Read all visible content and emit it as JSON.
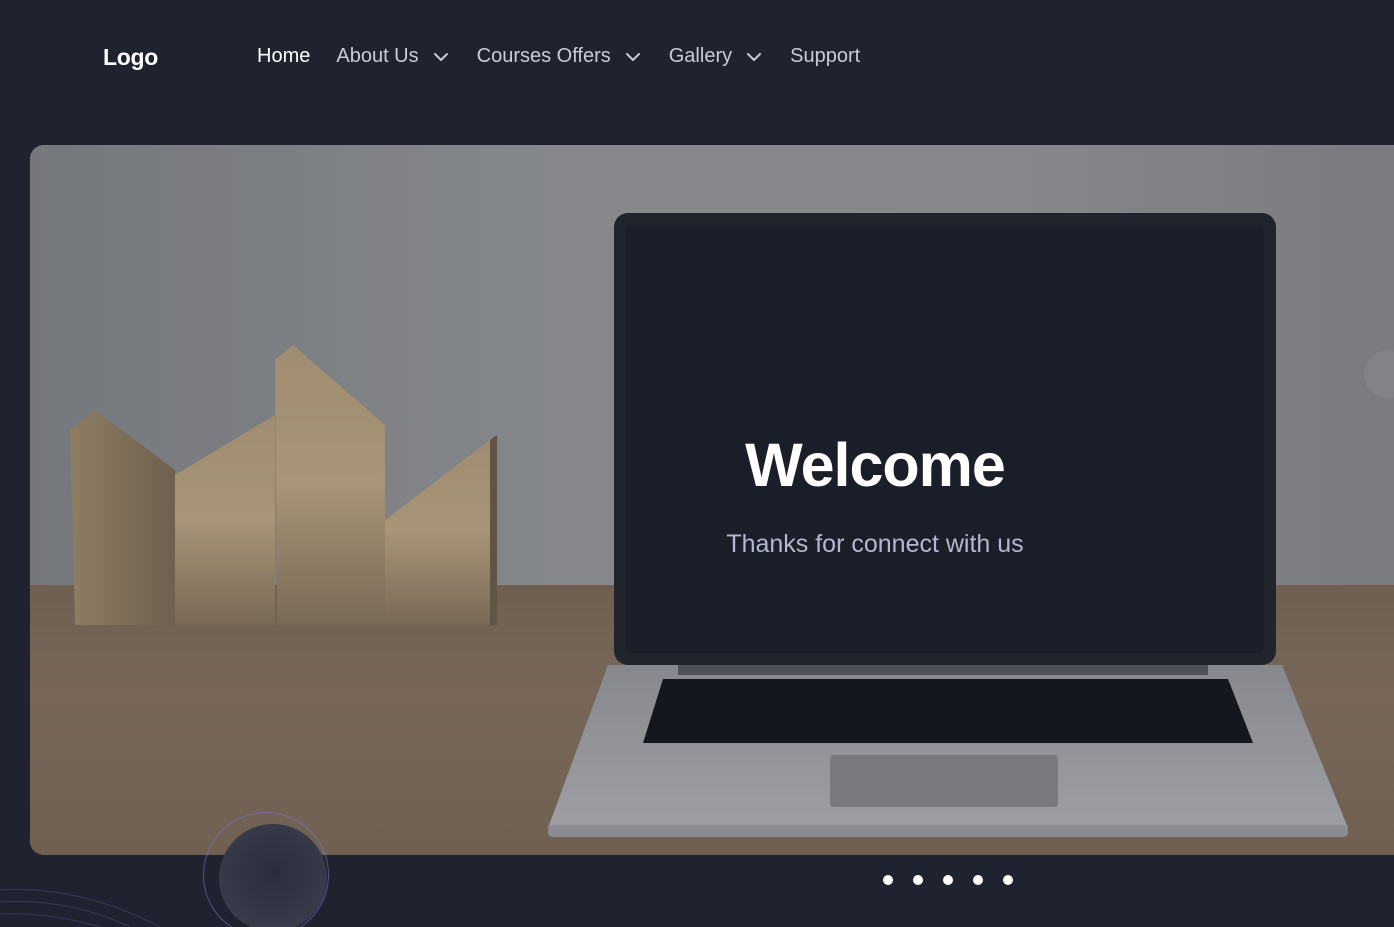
{
  "nav": {
    "logo": "Logo",
    "items": [
      {
        "label": "Home",
        "active": true,
        "dropdown": false
      },
      {
        "label": "About Us",
        "active": false,
        "dropdown": true
      },
      {
        "label": "Courses Offers",
        "active": false,
        "dropdown": true
      },
      {
        "label": "Gallery",
        "active": false,
        "dropdown": true
      },
      {
        "label": "Support",
        "active": false,
        "dropdown": false
      }
    ]
  },
  "hero": {
    "title": "Welcome",
    "subtitle": "Thanks for connect with us"
  },
  "slider": {
    "slide_count": 5
  },
  "colors": {
    "background": "#1f2330",
    "nav_text": "#c9ccd6",
    "active_text": "#ffffff",
    "subtitle": "#b3b8cf"
  },
  "icons": {
    "dropdown": "chevron-down-icon"
  }
}
